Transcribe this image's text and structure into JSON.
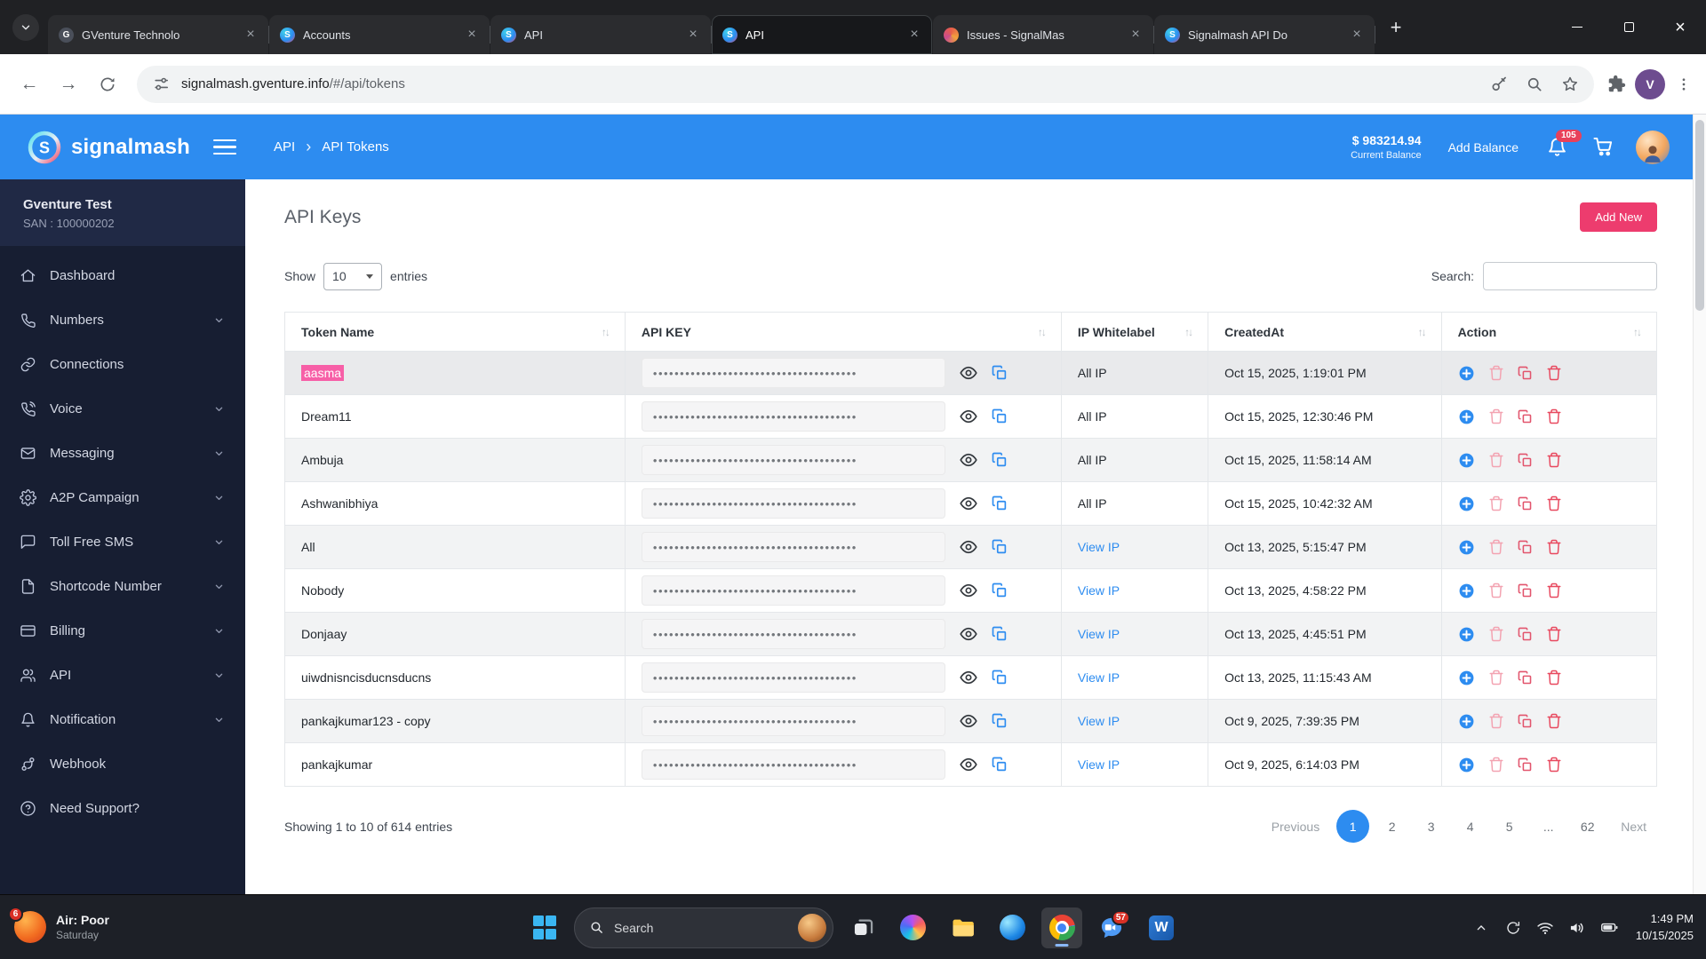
{
  "colors": {
    "accent_blue": "#2d8cf0",
    "accent_pink": "#ed3c6e",
    "sidebar_bg": "#171e32",
    "selection_highlight": "#f75fa7",
    "danger_red": "#e8495f"
  },
  "browser": {
    "tabs": [
      {
        "label": "GVenture Technolo",
        "icon": "gventure",
        "active": false
      },
      {
        "label": "Accounts",
        "icon": "signalmash",
        "active": false
      },
      {
        "label": "API",
        "icon": "signalmash",
        "active": false
      },
      {
        "label": "API",
        "icon": "signalmash",
        "active": true
      },
      {
        "label": "Issues - SignalMas",
        "icon": "issues",
        "active": false
      },
      {
        "label": "Signalmash API Do",
        "icon": "signalmash",
        "active": false
      }
    ],
    "url_domain": "signalmash.gventure.info",
    "url_path": "/#/api/tokens",
    "profile_initial": "V"
  },
  "app_header": {
    "brand": "signalmash",
    "breadcrumb": [
      "API",
      "API Tokens"
    ],
    "balance": "$ 983214.94",
    "balance_label": "Current Balance",
    "add_balance": "Add Balance",
    "notification_count": "105"
  },
  "sidebar": {
    "account_name": "Gventure Test",
    "account_san": "SAN : 100000202",
    "items": [
      {
        "label": "Dashboard",
        "icon": "home",
        "expandable": false
      },
      {
        "label": "Numbers",
        "icon": "phone",
        "expandable": true
      },
      {
        "label": "Connections",
        "icon": "link",
        "expandable": false
      },
      {
        "label": "Voice",
        "icon": "voice",
        "expandable": true
      },
      {
        "label": "Messaging",
        "icon": "mail",
        "expandable": true
      },
      {
        "label": "A2P Campaign",
        "icon": "gear",
        "expandable": true
      },
      {
        "label": "Toll Free SMS",
        "icon": "message",
        "expandable": true
      },
      {
        "label": "Shortcode Number",
        "icon": "file",
        "expandable": true
      },
      {
        "label": "Billing",
        "icon": "card",
        "expandable": true
      },
      {
        "label": "API",
        "icon": "users",
        "expandable": true
      },
      {
        "label": "Notification",
        "icon": "bell",
        "expandable": true
      },
      {
        "label": "Webhook",
        "icon": "branch",
        "expandable": false
      },
      {
        "label": "Need Support?",
        "icon": "help",
        "expandable": false
      }
    ]
  },
  "main": {
    "title": "API Keys",
    "add_new_label": "Add New",
    "show_label": "Show",
    "page_size": "10",
    "entries_label": "entries",
    "search_label": "Search:",
    "table": {
      "columns": [
        "Token Name",
        "API KEY",
        "IP Whitelabel",
        "CreatedAt",
        "Action"
      ],
      "masked_key": "••••••••••••••••••••••••••••••••••••••",
      "rows": [
        {
          "token": "aasma",
          "highlighted": true,
          "ip": "All IP",
          "ip_link": false,
          "created": "Oct 15, 2025, 1:19:01 PM"
        },
        {
          "token": "Dream11",
          "highlighted": false,
          "ip": "All IP",
          "ip_link": false,
          "created": "Oct 15, 2025, 12:30:46 PM"
        },
        {
          "token": "Ambuja",
          "highlighted": false,
          "ip": "All IP",
          "ip_link": false,
          "created": "Oct 15, 2025, 11:58:14 AM"
        },
        {
          "token": "Ashwanibhiya",
          "highlighted": false,
          "ip": "All IP",
          "ip_link": false,
          "created": "Oct 15, 2025, 10:42:32 AM"
        },
        {
          "token": "All",
          "highlighted": false,
          "ip": "View IP",
          "ip_link": true,
          "created": "Oct 13, 2025, 5:15:47 PM"
        },
        {
          "token": "Nobody",
          "highlighted": false,
          "ip": "View IP",
          "ip_link": true,
          "created": "Oct 13, 2025, 4:58:22 PM"
        },
        {
          "token": "Donjaay",
          "highlighted": false,
          "ip": "View IP",
          "ip_link": true,
          "created": "Oct 13, 2025, 4:45:51 PM"
        },
        {
          "token": "uiwdnisncisducnsducns",
          "highlighted": false,
          "ip": "View IP",
          "ip_link": true,
          "created": "Oct 13, 2025, 11:15:43 AM"
        },
        {
          "token": "pankajkumar123 - copy",
          "highlighted": false,
          "ip": "View IP",
          "ip_link": true,
          "created": "Oct 9, 2025, 7:39:35 PM"
        },
        {
          "token": "pankajkumar",
          "highlighted": false,
          "ip": "View IP",
          "ip_link": true,
          "created": "Oct 9, 2025, 6:14:03 PM"
        }
      ]
    },
    "footer": {
      "showing": "Showing 1 to 10 of 614 entries",
      "pages": [
        "Previous",
        "1",
        "2",
        "3",
        "4",
        "5",
        "...",
        "62",
        "Next"
      ],
      "active_page": "1"
    }
  },
  "taskbar": {
    "weather": {
      "badge": "6",
      "line1": "Air: Poor",
      "line2": "Saturday"
    },
    "search_label": "Search",
    "chat_badge": "57",
    "clock": {
      "time": "1:49 PM",
      "date": "10/15/2025"
    }
  }
}
